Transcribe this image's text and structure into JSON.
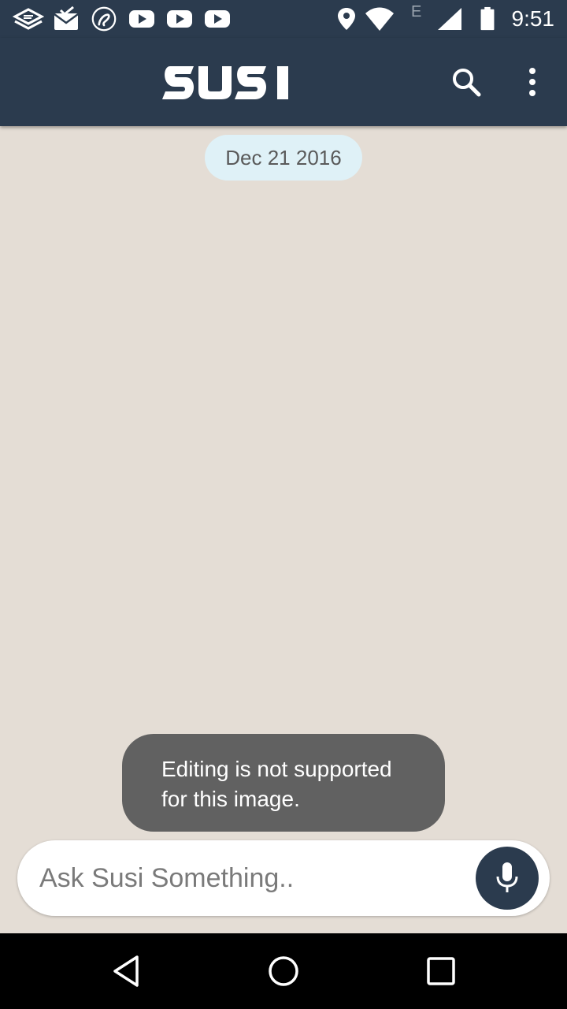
{
  "status_bar": {
    "time": "9:51",
    "network_letter": "E",
    "left_icons": [
      "layers-icon",
      "mail-check-icon",
      "airtel-icon",
      "youtube-icon",
      "youtube-icon",
      "youtube-icon"
    ],
    "right_icons": [
      "location-icon",
      "wifi-icon",
      "signal-icon",
      "battery-icon"
    ]
  },
  "app_bar": {
    "logo_text": "SUSI",
    "background": "#2b3b4e",
    "actions": [
      "search-icon",
      "more-vert-icon"
    ]
  },
  "chat": {
    "background": "#e4ddd5",
    "date_label": "Dec 21 2016"
  },
  "toast": {
    "line1": "Editing is not supported",
    "line2": "for this image."
  },
  "input": {
    "placeholder": "Ask Susi Something..",
    "value": ""
  },
  "nav_bar": {
    "buttons": [
      "back-icon",
      "home-icon",
      "recents-icon"
    ]
  }
}
